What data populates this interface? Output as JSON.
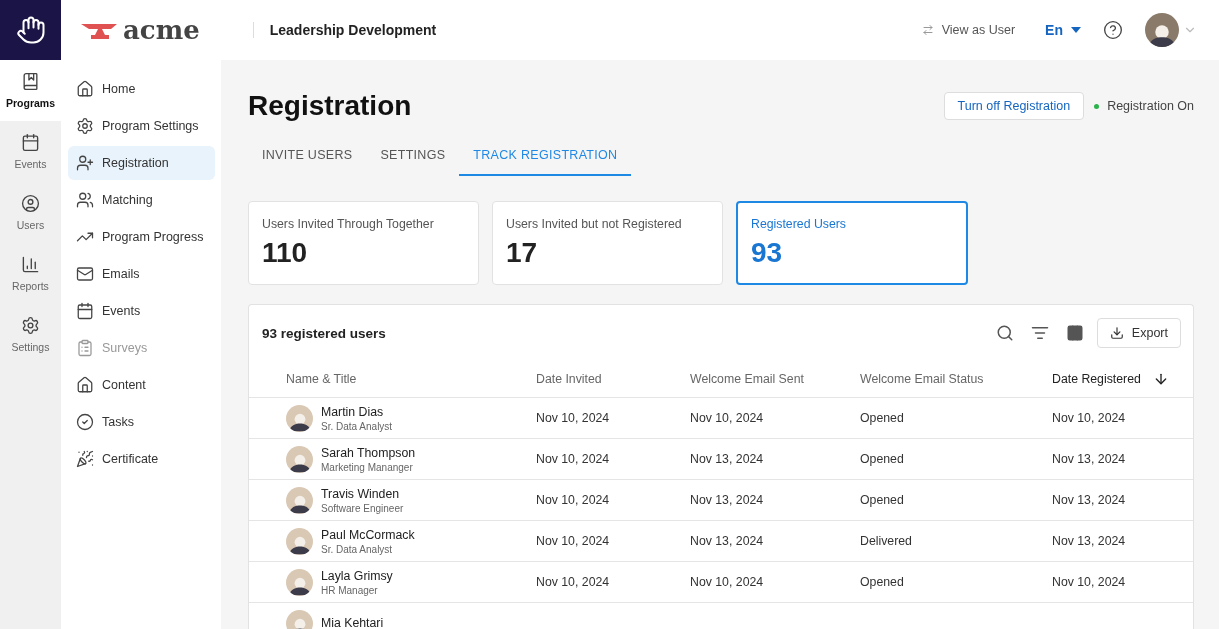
{
  "rail": {
    "items": [
      {
        "label": "Programs",
        "selected": true
      },
      {
        "label": "Events",
        "selected": false
      },
      {
        "label": "Users",
        "selected": false
      },
      {
        "label": "Reports",
        "selected": false
      },
      {
        "label": "Settings",
        "selected": false
      }
    ]
  },
  "header": {
    "brand": "acme",
    "program": "Leadership Development",
    "view_as": "View as User",
    "language": "En"
  },
  "sidebar": {
    "items": [
      {
        "label": "Home",
        "selected": false,
        "disabled": false
      },
      {
        "label": "Program Settings",
        "selected": false,
        "disabled": false
      },
      {
        "label": "Registration",
        "selected": true,
        "disabled": false
      },
      {
        "label": "Matching",
        "selected": false,
        "disabled": false
      },
      {
        "label": "Program Progress",
        "selected": false,
        "disabled": false
      },
      {
        "label": "Emails",
        "selected": false,
        "disabled": false
      },
      {
        "label": "Events",
        "selected": false,
        "disabled": false
      },
      {
        "label": "Surveys",
        "selected": false,
        "disabled": true
      },
      {
        "label": "Content",
        "selected": false,
        "disabled": false
      },
      {
        "label": "Tasks",
        "selected": false,
        "disabled": false
      },
      {
        "label": "Certificate",
        "selected": false,
        "disabled": false
      }
    ]
  },
  "page": {
    "title": "Registration",
    "toggle_button": "Turn off Registration",
    "status": {
      "label": "Registration On",
      "on": true
    }
  },
  "tabs": [
    {
      "label": "INVITE USERS",
      "selected": false
    },
    {
      "label": "SETTINGS",
      "selected": false
    },
    {
      "label": "TRACK REGISTRATION",
      "selected": true
    }
  ],
  "stats": [
    {
      "label": "Users Invited Through Together",
      "value": "110",
      "selected": false
    },
    {
      "label": "Users Invited but not Registered",
      "value": "17",
      "selected": false
    },
    {
      "label": "Registered Users",
      "value": "93",
      "selected": true
    }
  ],
  "table": {
    "title": "93 registered users",
    "export": "Export",
    "columns": [
      {
        "label": "Name & Title",
        "sorted": false
      },
      {
        "label": "Date Invited",
        "sorted": false
      },
      {
        "label": "Welcome Email Sent",
        "sorted": false
      },
      {
        "label": "Welcome Email Status",
        "sorted": false
      },
      {
        "label": "Date Registered",
        "sorted": true
      }
    ],
    "rows": [
      {
        "name": "Martin Dias",
        "title": "Sr. Data Analyst",
        "date_invited": "Nov 10, 2024",
        "email_sent": "Nov 10, 2024",
        "status": "Opened",
        "date_registered": "Nov 10, 2024"
      },
      {
        "name": "Sarah Thompson",
        "title": "Marketing Mananger",
        "date_invited": "Nov 10, 2024",
        "email_sent": "Nov 13, 2024",
        "status": "Opened",
        "date_registered": "Nov 13, 2024"
      },
      {
        "name": "Travis Winden",
        "title": "Software Engineer",
        "date_invited": "Nov 10, 2024",
        "email_sent": "Nov 13, 2024",
        "status": "Opened",
        "date_registered": "Nov 13, 2024"
      },
      {
        "name": "Paul McCormack",
        "title": "Sr. Data Analyst",
        "date_invited": "Nov 10, 2024",
        "email_sent": "Nov 13, 2024",
        "status": "Delivered",
        "date_registered": "Nov 13, 2024"
      },
      {
        "name": "Layla Grimsy",
        "title": "HR Manager",
        "date_invited": "Nov 10, 2024",
        "email_sent": "Nov 10, 2024",
        "status": "Opened",
        "date_registered": "Nov 10, 2024"
      },
      {
        "name": "Mia Kehtari"
      }
    ]
  }
}
